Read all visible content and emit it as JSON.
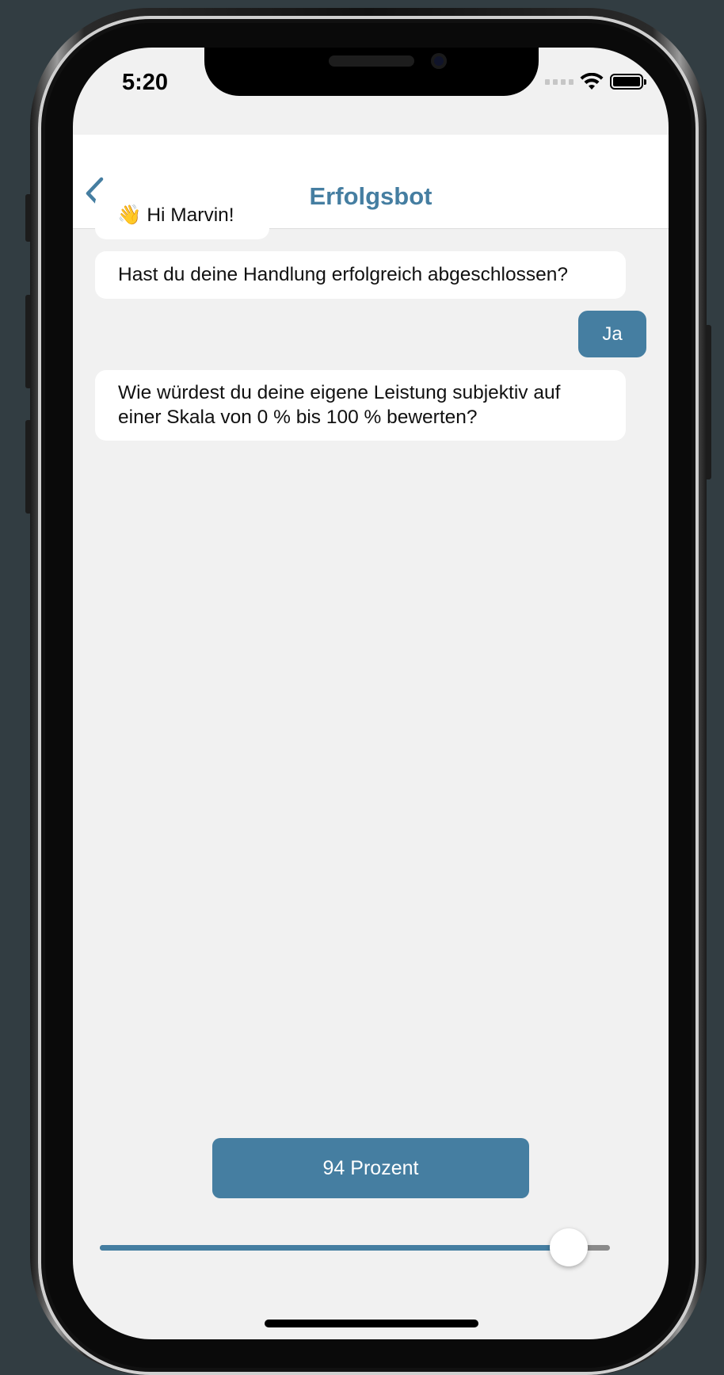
{
  "status_bar": {
    "time": "5:20",
    "wifi_icon": "wifi-icon",
    "battery_icon": "battery-icon"
  },
  "header": {
    "title": "Erfolgsbot",
    "back_icon": "chevron-left-icon"
  },
  "messages": [
    {
      "sender": "bot",
      "emoji": "👋",
      "text": "Hi Marvin!"
    },
    {
      "sender": "bot",
      "text": "Hast du deine Handlung erfolgreich abgeschlossen?"
    },
    {
      "sender": "user",
      "text": "Ja"
    },
    {
      "sender": "bot",
      "text": "Wie würdest du deine eigene Leistung subjektiv auf einer Skala von 0 % bis 100 % bewerten?"
    }
  ],
  "answer": {
    "label": "94 Prozent"
  },
  "slider": {
    "min": 0,
    "max": 100,
    "value": 94
  },
  "colors": {
    "accent": "#457ea1",
    "background": "#f1f1f1",
    "bubble": "#ffffff",
    "frame": "#323d42"
  }
}
